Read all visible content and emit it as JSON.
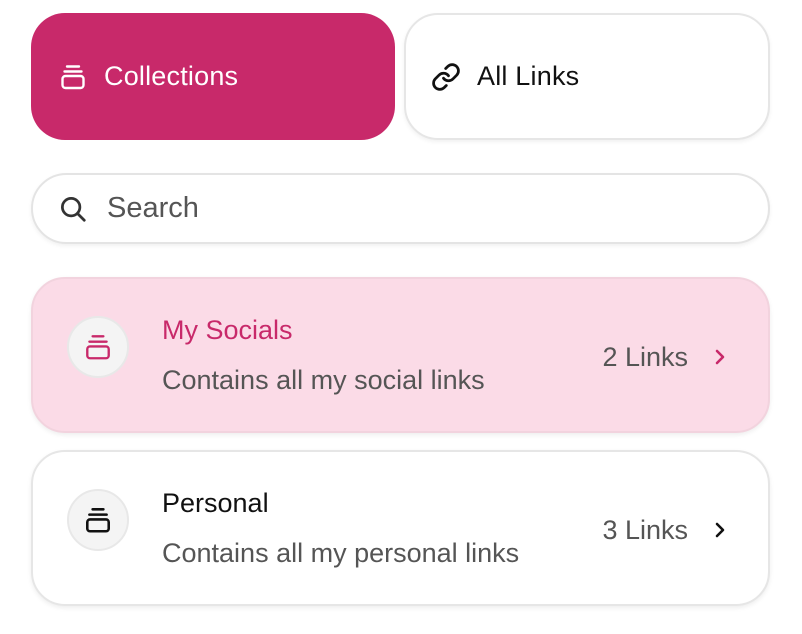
{
  "tabs": {
    "collections": {
      "label": "Collections",
      "icon": "collection-stack-icon",
      "active": true
    },
    "all_links": {
      "label": "All Links",
      "icon": "link-icon",
      "active": false
    }
  },
  "search": {
    "placeholder": "Search",
    "value": "",
    "icon": "search-icon"
  },
  "collections": [
    {
      "title": "My Socials",
      "description": "Contains all my social links",
      "count": "2 Links",
      "selected": true,
      "icon": "collection-stack-icon"
    },
    {
      "title": "Personal",
      "description": "Contains all my personal links",
      "count": "3 Links",
      "selected": false,
      "icon": "collection-stack-icon"
    }
  ],
  "colors": {
    "accent": "#c8296a",
    "selected_card_bg": "#fbdbe7",
    "text_primary": "#111111",
    "text_secondary": "#555555"
  }
}
